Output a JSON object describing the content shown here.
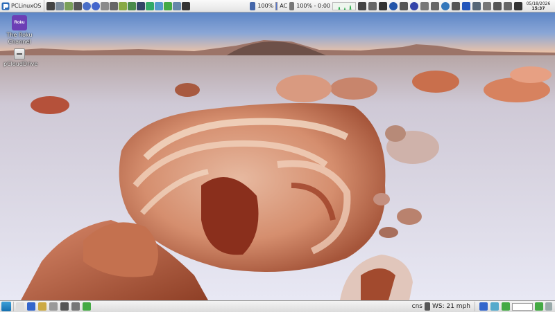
{
  "top_panel": {
    "menu_label": "PCLinuxOS",
    "launchers": [
      {
        "icon": "terminal-icon",
        "color": "#444444"
      },
      {
        "icon": "system-settings-icon",
        "color": "#7a8a9a"
      },
      {
        "icon": "text-editor-icon",
        "color": "#7aa05a"
      },
      {
        "icon": "brush-icon",
        "color": "#555555"
      },
      {
        "icon": "help-icon",
        "color": "#4a6fc8"
      },
      {
        "icon": "browser-icon",
        "color": "#4466cc"
      },
      {
        "icon": "mail-icon",
        "color": "#8a8a8a"
      },
      {
        "icon": "calculator-icon",
        "color": "#666666"
      },
      {
        "icon": "package-manager-icon",
        "color": "#88aa44"
      },
      {
        "icon": "search-icon",
        "color": "#4a8a4a"
      },
      {
        "icon": "monitor-icon",
        "color": "#334466"
      },
      {
        "icon": "chart-icon",
        "color": "#33aa66"
      },
      {
        "icon": "image-icon",
        "color": "#5599cc"
      },
      {
        "icon": "spreadsheet-icon",
        "color": "#44aa44"
      },
      {
        "icon": "music-icon",
        "color": "#6688aa"
      },
      {
        "icon": "video-icon",
        "color": "#333333"
      }
    ],
    "cpu_percent": "100%",
    "power_source": "AC",
    "battery": "100% - 0:00",
    "tray_icons": [
      {
        "icon": "network-down-icon",
        "color": "#444444"
      },
      {
        "icon": "usb-icon",
        "color": "#666666"
      },
      {
        "icon": "save-icon",
        "color": "#333333"
      },
      {
        "icon": "shield-icon",
        "color": "#2255aa"
      },
      {
        "icon": "keyboard-icon",
        "color": "#555555"
      },
      {
        "icon": "record-icon",
        "color": "#3344aa"
      },
      {
        "icon": "mail-notify-icon",
        "color": "#777777"
      },
      {
        "icon": "radar-icon",
        "color": "#666666"
      },
      {
        "icon": "globe-icon",
        "color": "#3377bb"
      },
      {
        "icon": "magnet-icon",
        "color": "#555555"
      },
      {
        "icon": "bluetooth-icon",
        "color": "#2255bb"
      },
      {
        "icon": "network-icon",
        "color": "#556677"
      },
      {
        "icon": "updates-icon",
        "color": "#777777"
      },
      {
        "icon": "clipboard-icon",
        "color": "#555555"
      },
      {
        "icon": "battery-icon",
        "color": "#666666"
      },
      {
        "icon": "volume-icon",
        "color": "#333333"
      }
    ],
    "date": "05/18/2026",
    "time": "15:37"
  },
  "desktop": {
    "icons": [
      {
        "label": "The Roku Channel",
        "pic_text": "Roku"
      },
      {
        "label": "pCloudDrive",
        "pic_text": ""
      }
    ]
  },
  "bottom_panel": {
    "taskbar_launchers": [
      {
        "icon": "show-desktop-icon",
        "color": "#dddddd"
      },
      {
        "icon": "browser-icon",
        "color": "#3366cc"
      },
      {
        "icon": "file-manager-icon",
        "color": "#ccaa44"
      },
      {
        "icon": "text-editor-icon",
        "color": "#999999"
      },
      {
        "icon": "terminal-icon",
        "color": "#555555"
      },
      {
        "icon": "network-icon",
        "color": "#777777"
      },
      {
        "icon": "package-manager-icon",
        "color": "#44aa44"
      }
    ],
    "weather_station": "cns",
    "weather": "WS: 21 mph",
    "tray_icons": [
      {
        "icon": "browser-icon",
        "color": "#3366cc"
      },
      {
        "icon": "monitor-icon",
        "color": "#55aacc"
      },
      {
        "icon": "package-manager-icon",
        "color": "#44aa44"
      }
    ]
  }
}
